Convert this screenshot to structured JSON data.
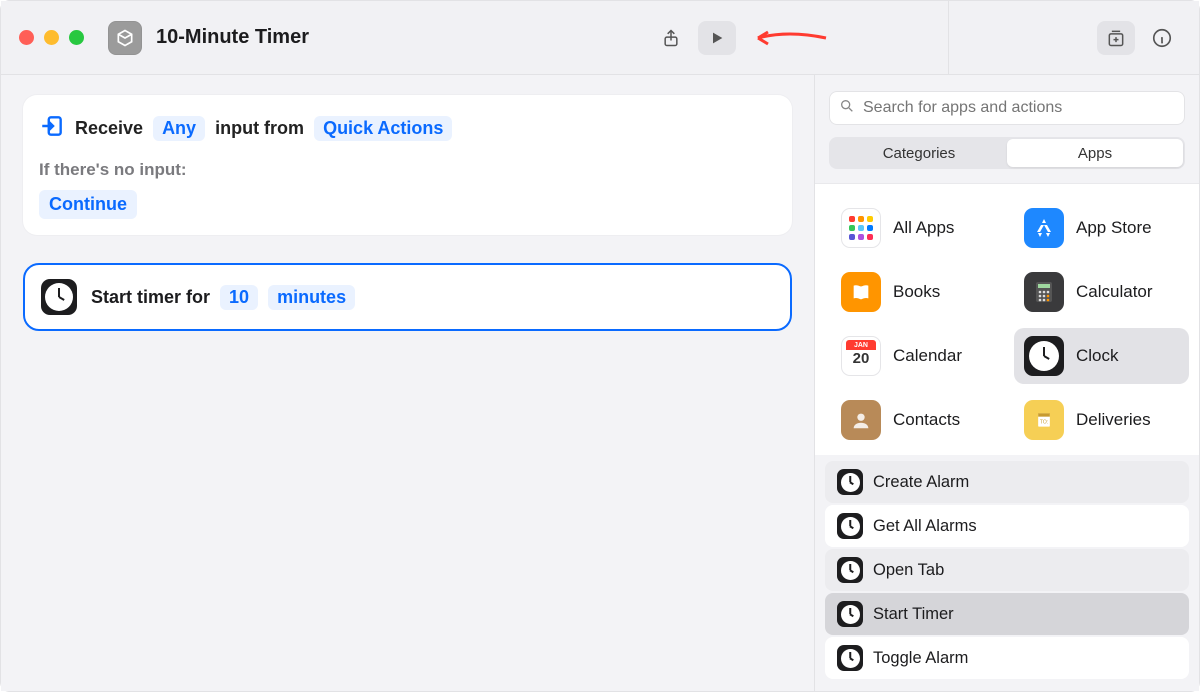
{
  "header": {
    "title": "10-Minute Timer"
  },
  "receive": {
    "prefix": "Receive",
    "any": "Any",
    "mid": "input from",
    "source": "Quick Actions",
    "noinput_label": "If there's no input:",
    "continue": "Continue"
  },
  "action": {
    "prefix": "Start timer for",
    "value": "10",
    "unit": "minutes"
  },
  "sidebar": {
    "search_placeholder": "Search for apps and actions",
    "tabs": {
      "categories": "Categories",
      "apps": "Apps"
    },
    "apps": {
      "allapps": "All Apps",
      "appstore": "App Store",
      "books": "Books",
      "calculator": "Calculator",
      "calendar": "Calendar",
      "clock": "Clock",
      "contacts": "Contacts",
      "deliveries": "Deliveries",
      "cal_month": "JAN",
      "cal_day": "20"
    },
    "actions": {
      "create_alarm": "Create Alarm",
      "get_all_alarms": "Get All Alarms",
      "open_tab": "Open Tab",
      "start_timer": "Start Timer",
      "toggle_alarm": "Toggle Alarm"
    }
  }
}
